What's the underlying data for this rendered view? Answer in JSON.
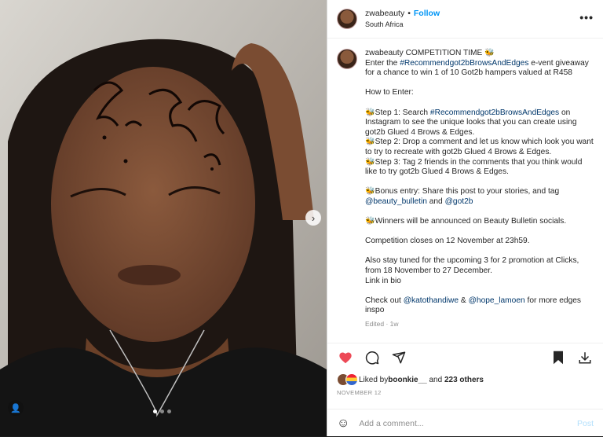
{
  "header": {
    "username": "zwabeauty",
    "follow_label": "Follow",
    "location": "South Africa",
    "more_icon": "more-horizontal-icon"
  },
  "caption": {
    "username": "zwabeauty",
    "lines": [
      {
        "text": "COMPETITION TIME 🐝",
        "first": true
      },
      {
        "parts": [
          {
            "t": "Enter the "
          },
          {
            "t": "#Recommendgot2bBrowsAndEdges",
            "tag": true
          },
          {
            "t": " e-vent giveaway"
          }
        ]
      },
      {
        "parts": [
          {
            "t": "for a chance to win 1 of 10 Got2b hampers valued at R458"
          }
        ]
      },
      {
        "parts": [
          {
            "t": ""
          }
        ]
      },
      {
        "parts": [
          {
            "t": "How to Enter:"
          }
        ]
      },
      {
        "parts": [
          {
            "t": ""
          }
        ]
      },
      {
        "parts": [
          {
            "t": "🐝Step 1: Search "
          },
          {
            "t": "#Recommendgot2bBrowsAndEdges",
            "tag": true
          },
          {
            "t": " on"
          }
        ]
      },
      {
        "parts": [
          {
            "t": "Instagram to see the unique looks that you can create using"
          }
        ]
      },
      {
        "parts": [
          {
            "t": "got2b Glued 4 Brows & Edges."
          }
        ]
      },
      {
        "parts": [
          {
            "t": "🐝Step 2: Drop a comment and let us know which look you want"
          }
        ]
      },
      {
        "parts": [
          {
            "t": "to try to recreate with got2b Glued 4 Brows & Edges."
          }
        ]
      },
      {
        "parts": [
          {
            "t": "🐝Step 3: Tag 2 friends in the comments that you think would"
          }
        ]
      },
      {
        "parts": [
          {
            "t": "like to try got2b Glued 4 Brows & Edges."
          }
        ]
      },
      {
        "parts": [
          {
            "t": ""
          }
        ]
      },
      {
        "parts": [
          {
            "t": "🐝Bonus entry: Share this post to your stories, and tag"
          }
        ]
      },
      {
        "parts": [
          {
            "t": "@beauty_bulletin",
            "tag": true
          },
          {
            "t": " and "
          },
          {
            "t": "@got2b",
            "tag": true
          }
        ]
      },
      {
        "parts": [
          {
            "t": ""
          }
        ]
      },
      {
        "parts": [
          {
            "t": "🐝Winners will be announced on Beauty Bulletin socials."
          }
        ]
      },
      {
        "parts": [
          {
            "t": ""
          }
        ]
      },
      {
        "parts": [
          {
            "t": "Competition closes on 12 November at 23h59."
          }
        ]
      },
      {
        "parts": [
          {
            "t": ""
          }
        ]
      },
      {
        "parts": [
          {
            "t": "Also stay tuned for the upcoming 3 for 2 promotion at Clicks,"
          }
        ]
      },
      {
        "parts": [
          {
            "t": "from 18 November to 27 December."
          }
        ]
      },
      {
        "parts": [
          {
            "t": "Link in bio"
          }
        ]
      },
      {
        "parts": [
          {
            "t": ""
          }
        ]
      },
      {
        "parts": [
          {
            "t": "Check out "
          },
          {
            "t": "@katothandiwe",
            "tag": true
          },
          {
            "t": " & "
          },
          {
            "t": "@hope_lamoen",
            "tag": true
          },
          {
            "t": " for more edges"
          }
        ]
      },
      {
        "parts": [
          {
            "t": "inspo"
          }
        ]
      }
    ],
    "meta": "Edited · 1w"
  },
  "actions": {
    "like_icon": "heart-filled-icon",
    "comment_icon": "comment-icon",
    "share_icon": "send-icon",
    "save_icon": "bookmark-icon",
    "download_icon": "download-icon",
    "liked_by_prefix": "Liked by ",
    "liked_by_user": "boonkie__",
    "liked_by_suffix": " and ",
    "others": "223 others",
    "date": "NOVEMBER 12"
  },
  "comment": {
    "placeholder": "Add a comment...",
    "post_label": "Post"
  },
  "colors": {
    "link": "#00376b",
    "follow": "#0095f6",
    "heart": "#ed4956"
  }
}
